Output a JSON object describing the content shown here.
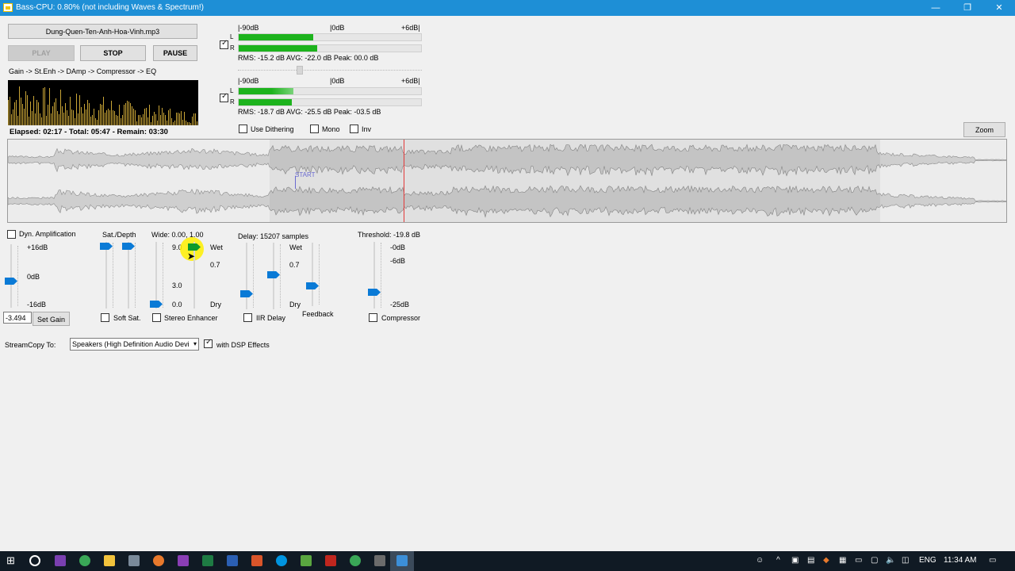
{
  "window": {
    "title": "Bass-CPU: 0.80% (not including Waves & Spectrum!)",
    "minimize": "—",
    "restore": "❐",
    "close": "✕"
  },
  "player": {
    "filename": "Dung-Quen-Ten-Anh-Hoa-Vinh.mp3",
    "play_label": "PLAY",
    "stop_label": "STOP",
    "pause_label": "PAUSE",
    "chain": "Gain -> St.Enh -> DAmp -> Compressor -> EQ",
    "elapsed": "Elapsed: 02:17 - Total: 05:47 - Remain: 03:30"
  },
  "meters": {
    "m1": {
      "scale_left": "|-90dB",
      "scale_mid": "|0dB",
      "scale_right": "+6dB|",
      "l": "L",
      "r": "R",
      "stats": "RMS: -15.2 dB   AVG: -22.0 dB   Peak: 00.0 dB",
      "checked": true,
      "level_l": 0.41,
      "level_r": 0.43
    },
    "m2": {
      "scale_left": "|-90dB",
      "scale_mid": "|0dB",
      "scale_right": "+6dB|",
      "l": "L",
      "r": "R",
      "stats": "RMS: -18.7 dB   AVG: -25.5 dB   Peak: -03.5 dB",
      "checked": true,
      "level_l": 0.3,
      "level_r": 0.29
    }
  },
  "options": {
    "dithering": "Use Dithering",
    "mono": "Mono",
    "inv": "Inv",
    "zoom": "Zoom"
  },
  "wave": {
    "marker": "START"
  },
  "dsp": {
    "dynamp": "Dyn. Amplification",
    "gain_top": "+16dB",
    "gain_mid": "0dB",
    "gain_bot": "-16dB",
    "gain_value": "-3.494",
    "set_gain": "Set Gain",
    "sat_depth": "Sat./Depth",
    "soft_sat": "Soft Sat.",
    "wide": "Wide: 0.00, 1.00",
    "wide_90": "9.0",
    "wide_30": "3.0",
    "wide_00": "0.0",
    "wet1": "Wet",
    "wet_07_1": "0.7",
    "dry1": "Dry",
    "stereo_enh": "Stereo Enhancer",
    "delay": "Delay: 15207 samples",
    "wet2": "Wet",
    "wet_07_2": "0.7",
    "dry2": "Dry",
    "feedback": "Feedback",
    "iir_delay": "IIR Delay",
    "threshold": "Threshold: -19.8 dB",
    "thr_0": "-0dB",
    "thr_6": "-6dB",
    "thr_25": "-25dB",
    "compressor": "Compressor"
  },
  "streamcopy": {
    "label": "StreamCopy To:",
    "device": "Speakers (High Definition Audio Devi",
    "dsp_effects": "with DSP Effects"
  },
  "taskbar": {
    "lang": "ENG",
    "time": "11:34 AM"
  },
  "colors": {
    "titlebar": "#1e8fd6",
    "meter_green": "#1db31d",
    "slider_blue": "#0a7ad6",
    "playhead": "#e23a3a",
    "spectrum_bar": "#c8a436"
  }
}
